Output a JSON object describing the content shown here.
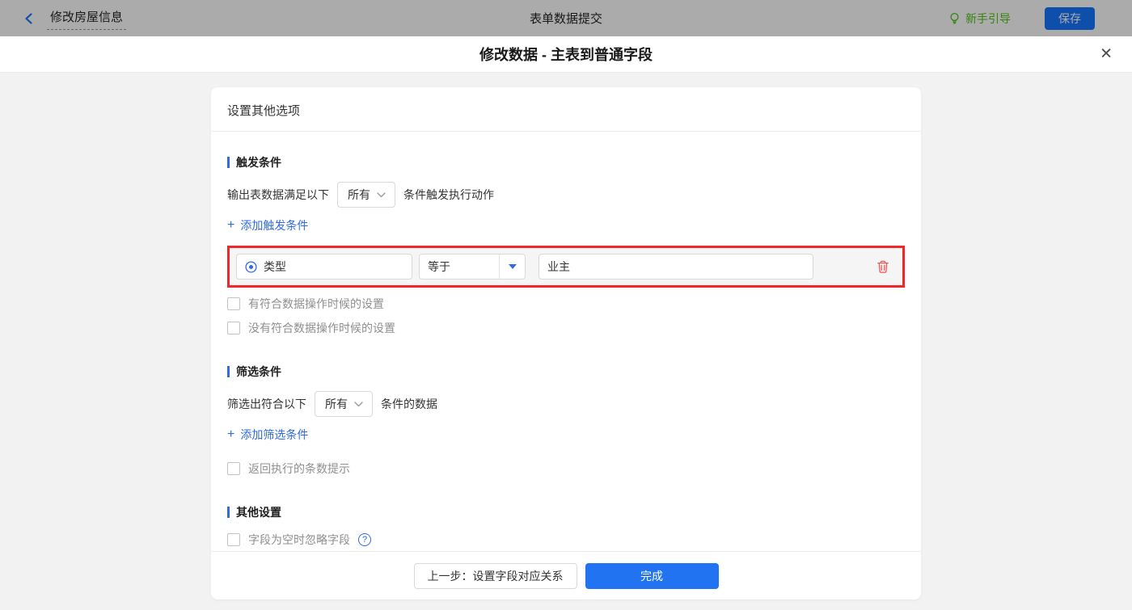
{
  "icons": {
    "plus": "+",
    "question": "?",
    "close": "✕"
  },
  "topbar": {
    "back_title": "修改房屋信息",
    "center_title": "表单数据提交",
    "guide_label": "新手引导",
    "save_label": "保存"
  },
  "modal": {
    "title": "修改数据 - 主表到普通字段"
  },
  "panel": {
    "header_title": "设置其他选项",
    "trigger": {
      "title": "触发条件",
      "rule_prefix": "输出表数据满足以下",
      "rule_select": "所有",
      "rule_suffix": "条件触发执行动作",
      "add_label": "添加触发条件",
      "condition": {
        "field": "类型",
        "operator": "等于",
        "value": "业主"
      },
      "checkboxes": [
        "有符合数据操作时候的设置",
        "没有符合数据操作时候的设置"
      ]
    },
    "filter": {
      "title": "筛选条件",
      "rule_prefix": "筛选出符合以下",
      "rule_select": "所有",
      "rule_suffix": "条件的数据",
      "add_label": "添加筛选条件",
      "checkboxes": [
        "返回执行的条数提示"
      ]
    },
    "other": {
      "title": "其他设置",
      "checkboxes": [
        "字段为空时忽略字段"
      ]
    },
    "footer": {
      "prev_label": "上一步：设置字段对应关系",
      "done_label": "完成"
    }
  },
  "colors": {
    "accent_blue": "#2e6be4",
    "save_blue": "#1677ff",
    "done_blue": "#2173f2",
    "guide_green": "#52c41a",
    "danger_red": "#f12626",
    "dim_gray": "#a9a9a9",
    "body_gray": "#f2f2f2"
  }
}
